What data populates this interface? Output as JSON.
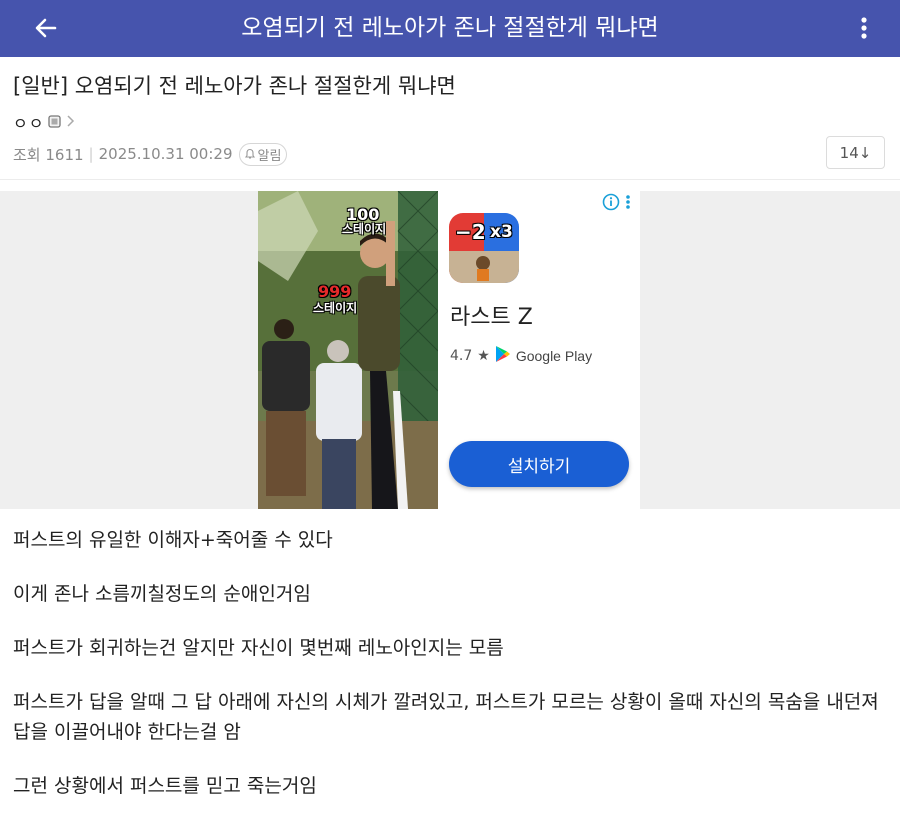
{
  "header": {
    "title": "오염되기 전 레노아가 존나 절절한게 뭐냐면",
    "background": "#4654ad"
  },
  "post": {
    "title": "[일반] 오염되기 전 레노아가 존나 절절한게 뭐냐면",
    "author": "ㅇㅇ",
    "views_label": "조회 1611",
    "datetime": "2025.10.31 00:29",
    "alarm_label": "알림",
    "comment_count": "14↓"
  },
  "ad": {
    "video_overlay": {
      "stage_top_number": "100",
      "stage_top_label": "스테이지",
      "stage_bottom_number": "999",
      "stage_bottom_label": "스테이지"
    },
    "icon_text_left": "−2",
    "icon_text_right": "x3",
    "app_name": "라스트 Z",
    "rating": "4.7",
    "store_label": "Google Play",
    "install_label": "설치하기",
    "install_color": "#1a5fd4"
  },
  "body": {
    "paragraphs": [
      "퍼스트의 유일한 이해자+죽어줄 수 있다",
      "이게 존나 소름끼칠정도의 순애인거임",
      "퍼스트가 회귀하는건 알지만 자신이 몇번째 레노아인지는 모름",
      "퍼스트가 답을 알때 그 답 아래에 자신의 시체가 깔려있고, 퍼스트가 모르는 상황이 올때 자신의 목숨을 내던져 답을 이끌어내야 한다는걸 암",
      "그런 상황에서 퍼스트를 믿고 죽는거임"
    ]
  }
}
